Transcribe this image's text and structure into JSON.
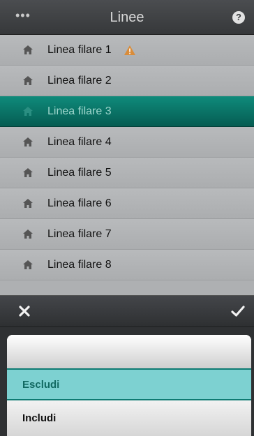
{
  "header": {
    "title": "Linee",
    "menu_glyph": "•••",
    "help_glyph": "?"
  },
  "lines": [
    {
      "label": "Linea filare 1",
      "warning": true,
      "selected": false
    },
    {
      "label": "Linea filare 2",
      "warning": false,
      "selected": false
    },
    {
      "label": "Linea filare 3",
      "warning": false,
      "selected": true
    },
    {
      "label": "Linea filare 4",
      "warning": false,
      "selected": false
    },
    {
      "label": "Linea filare 5",
      "warning": false,
      "selected": false
    },
    {
      "label": "Linea filare 6",
      "warning": false,
      "selected": false
    },
    {
      "label": "Linea filare 7",
      "warning": false,
      "selected": false
    },
    {
      "label": "Linea filare 8",
      "warning": false,
      "selected": false
    }
  ],
  "picker": {
    "options": [
      {
        "label": "",
        "state": "empty"
      },
      {
        "label": "Escludi",
        "state": "selected"
      },
      {
        "label": "Includi",
        "state": "normal"
      }
    ]
  },
  "icons": {
    "row": "home-icon",
    "warning": "warning-icon",
    "cancel": "close-icon",
    "confirm": "checkmark-icon",
    "menu": "more-icon",
    "help": "help-icon"
  },
  "colors": {
    "accent": "#0a7a6c",
    "warning": "#d98c3a",
    "picker_selected": "#7dd1d1"
  }
}
